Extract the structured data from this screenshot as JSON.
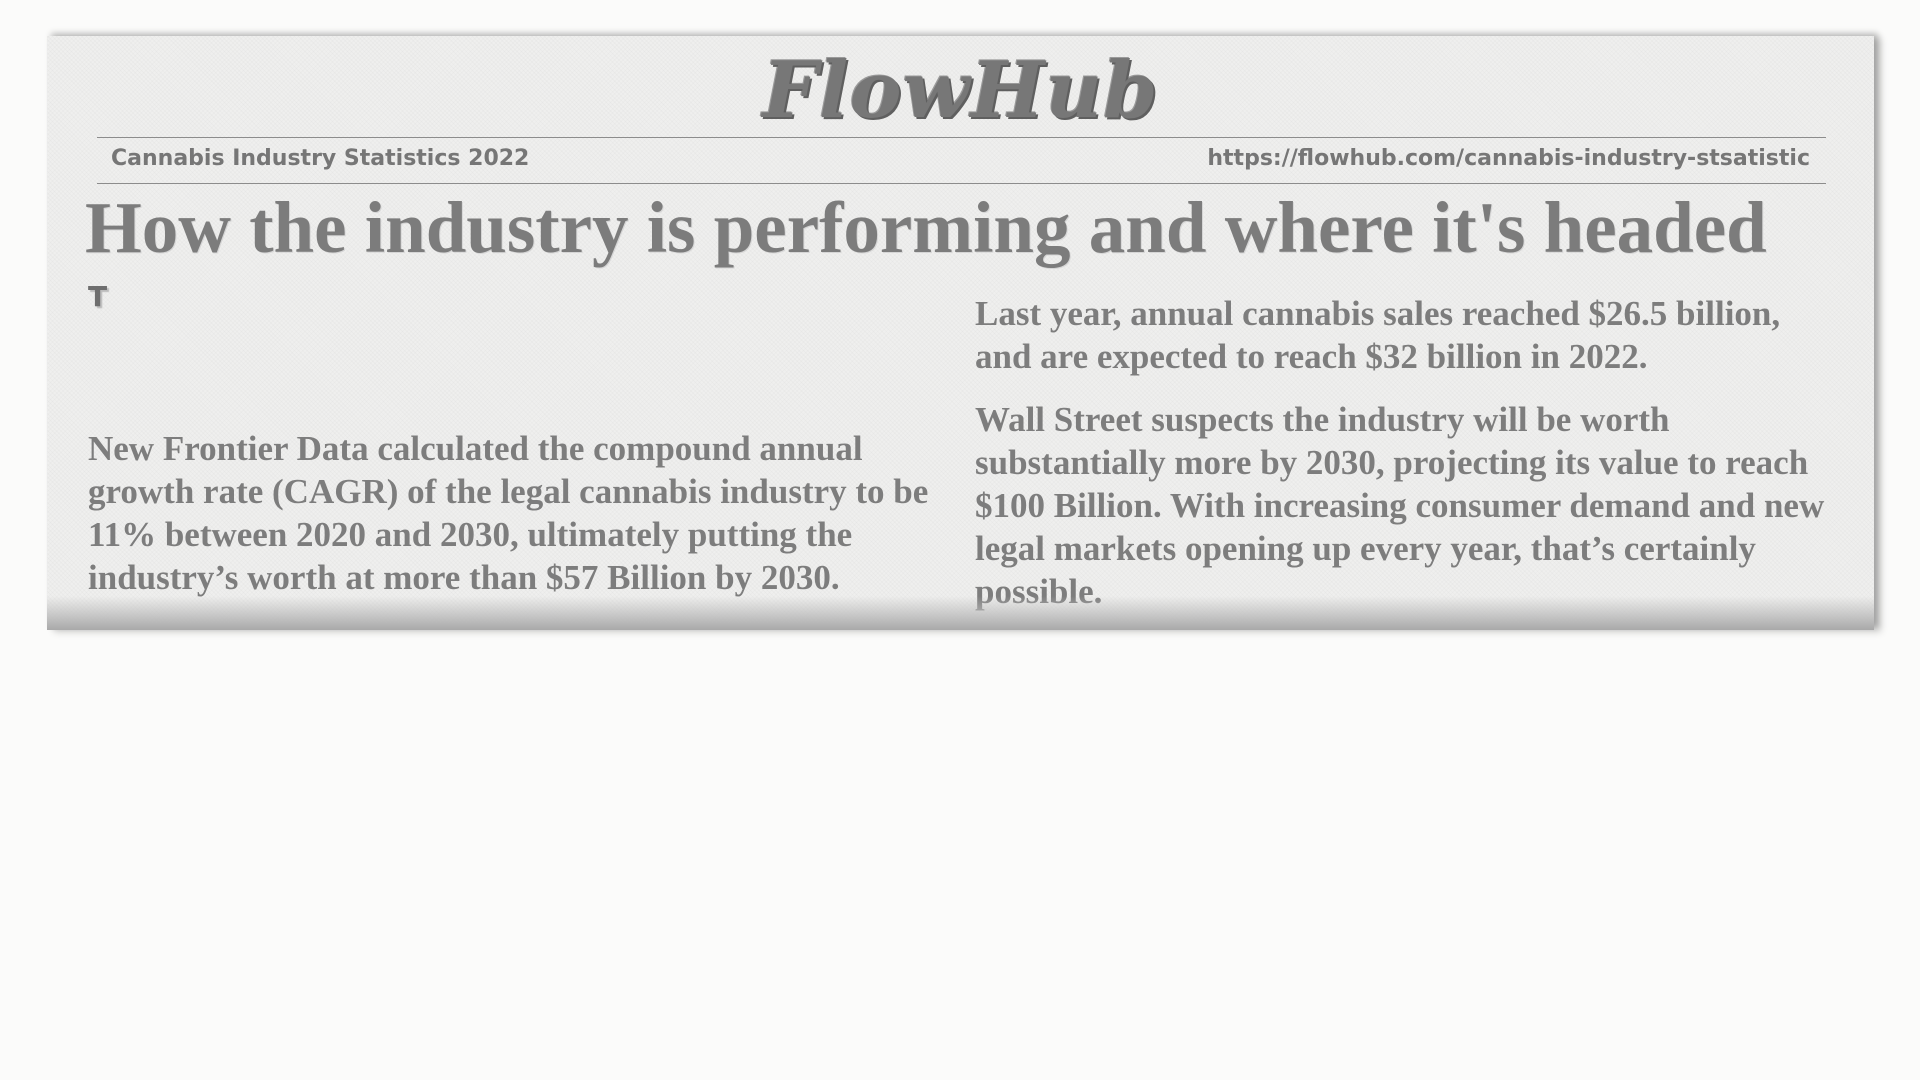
{
  "masthead": {
    "title": "FlowHub"
  },
  "meta": {
    "left": "Cannabis Industry Statistics 2022",
    "right": "https://flowhub.com/cannabis-industry-stsatistic"
  },
  "headline": "How the industry is performing and where it's headed",
  "dropcap": "T",
  "left_column": {
    "paragraph": "New Frontier Data calculated the compound annual growth rate (CAGR) of the legal cannabis industry to be 11% between 2020 and 2030, ultimately putting the industry’s worth at more than $57 Billion by 2030."
  },
  "right_column": {
    "paragraph_1": "Last year, annual cannabis sales reached $26.5 billion, and are expected to reach $32 billion in 2022.",
    "paragraph_2": "Wall Street suspects the industry will be worth substantially more by 2030, projecting its value to reach $100 Billion. With increasing consumer demand and new legal markets opening up every year, that’s certainly possible."
  }
}
